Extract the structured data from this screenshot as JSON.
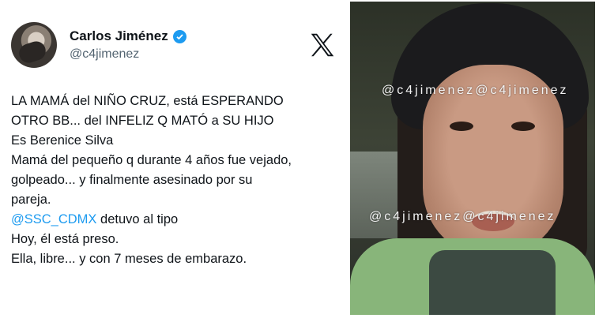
{
  "tweet": {
    "author_name": "Carlos Jiménez",
    "author_handle": "@c4jimenez",
    "lines": [
      {
        "text": "LA MAMÁ del NIÑO CRUZ, está ESPERANDO"
      },
      {
        "text": "OTRO BB... del INFELIZ Q MATÓ a SU HIJO"
      },
      {
        "text": "Es Berenice Silva"
      },
      {
        "text": "Mamá del pequeño q durante 4 años fue vejado,"
      },
      {
        "text": "golpeado... y finalmente asesinado por su"
      },
      {
        "text": "pareja."
      },
      {
        "text": "",
        "mention": "@SSC_CDMX",
        "after": " detuvo al tipo"
      },
      {
        "text": "Hoy, él está preso."
      },
      {
        "text": "Ella, libre... y con 7 meses de embarazo."
      }
    ],
    "colors": {
      "mention": "#1d9bf0",
      "verified": "#1d9bf0",
      "text": "#0f1419",
      "handle": "#536471"
    },
    "icons": {
      "verified": "verified-badge-icon",
      "platform": "x-logo-icon"
    }
  },
  "photo": {
    "watermark_top": "@c4jimenez@c4jimenez",
    "watermark_mid": "@c4jimenez@c4jimenez"
  }
}
